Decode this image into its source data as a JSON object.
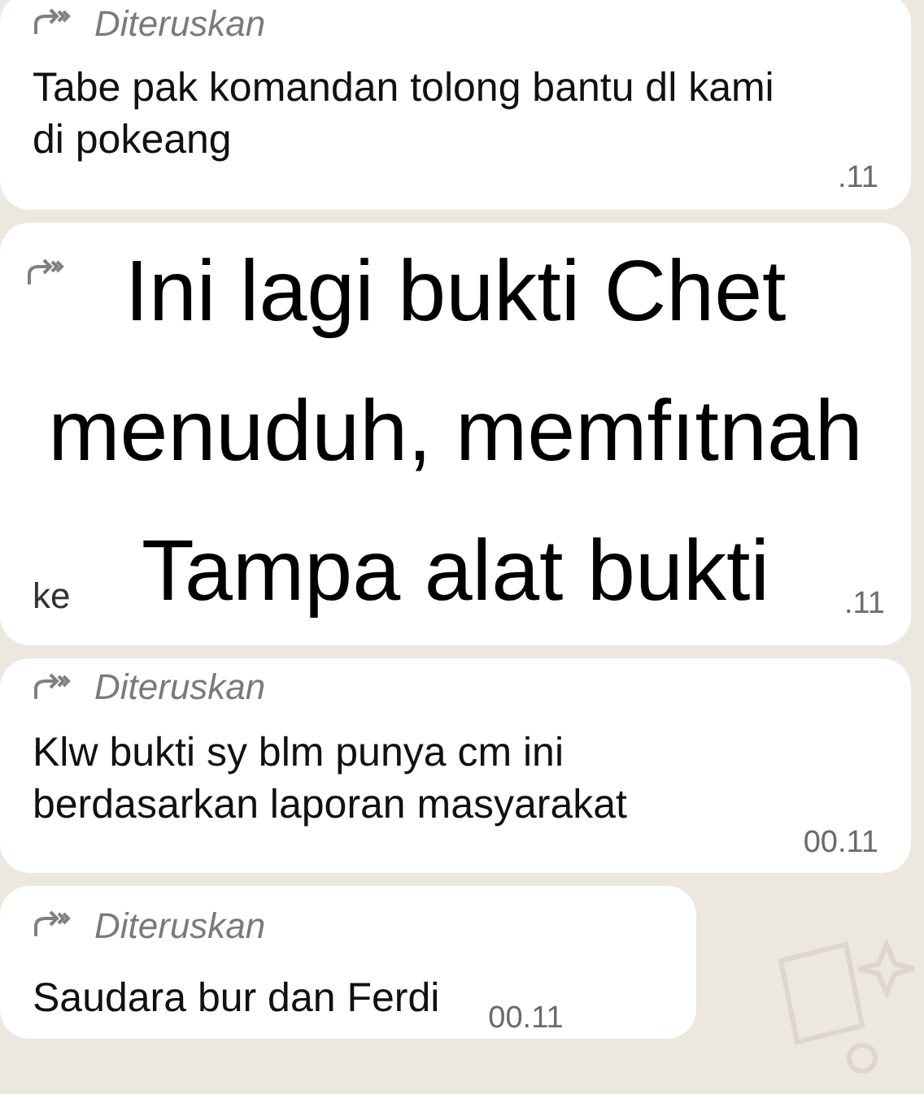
{
  "messages": [
    {
      "kind": "message",
      "forwarded_label": "Diteruskan",
      "text": "Tabe pak komandan tolong bantu dl kami di pokeang",
      "time": ".11"
    },
    {
      "kind": "overlay",
      "overlay_lines": [
        "Ini lagi bukti Chet",
        "menuduh, memfıtnah",
        "Tampa alat bukti"
      ],
      "fragment": "ke",
      "time": ".11"
    },
    {
      "kind": "message",
      "forwarded_label": "Diteruskan",
      "text": "Klw bukti sy blm punya cm ini berdasarkan laporan masyarakat",
      "time": "00.11"
    },
    {
      "kind": "short",
      "forwarded_label": "Diteruskan",
      "text": "Saudara bur dan Ferdi",
      "time": "00.11"
    }
  ]
}
